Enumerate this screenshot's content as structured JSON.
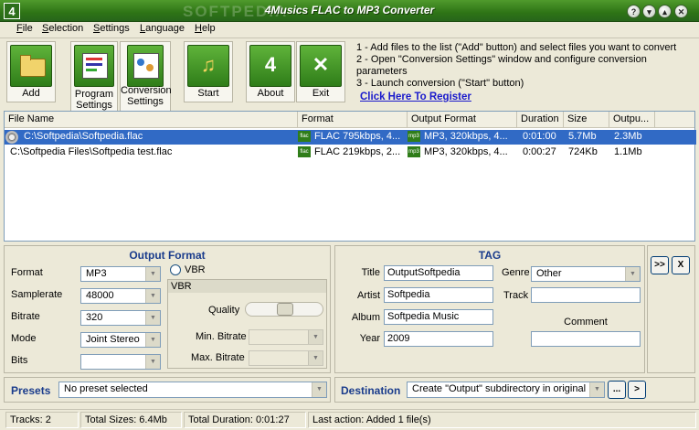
{
  "window": {
    "title": "4Musics FLAC to MP3 Converter",
    "icon_label": "4",
    "watermark": "SOFTPEDIA"
  },
  "titlebar_buttons": {
    "help": "?",
    "minimize": "▾",
    "maximize": "▴",
    "close": "✕"
  },
  "menu": [
    {
      "label": "File",
      "ul": "F",
      "rest": "ile"
    },
    {
      "label": "Selection",
      "ul": "S",
      "rest": "election"
    },
    {
      "label": "Settings",
      "ul": "S",
      "rest": "ettings"
    },
    {
      "label": "Language",
      "ul": "L",
      "rest": "anguage"
    },
    {
      "label": "Help",
      "ul": "H",
      "rest": "elp"
    }
  ],
  "toolbar": {
    "add": {
      "label": "Add",
      "icon": "folder-add-icon"
    },
    "program_settings": {
      "line1": "Program",
      "line2": "Settings",
      "icon": "program-settings-icon"
    },
    "conversion_settings": {
      "line1": "Conversion",
      "line2": "Settings",
      "icon": "conversion-settings-icon"
    },
    "start": {
      "label": "Start",
      "icon": "music-note-icon"
    },
    "about": {
      "label": "About",
      "icon": "about-4-icon",
      "glyph": "4"
    },
    "exit": {
      "label": "Exit",
      "icon": "exit-icon",
      "glyph": "✕"
    }
  },
  "instructions": [
    "1 - Add files to the list (\"Add\" button) and select files you want to convert",
    "2 - Open \"Conversion Settings\" window and configure conversion parameters",
    "3 - Launch conversion (\"Start\" button)"
  ],
  "register_link": "Click Here To Register",
  "filelist": {
    "columns": [
      "File Name",
      "Format",
      "Output Format",
      "Duration",
      "Size",
      "Outpu..."
    ],
    "rows": [
      {
        "name": "C:\\Softpedia\\Softpedia.flac",
        "format": "FLAC 795kbps, 4...",
        "output_format": "MP3, 320kbps, 4...",
        "duration": "0:01:00",
        "size": "5.7Mb",
        "output_size": "2.3Mb",
        "selected": true
      },
      {
        "name": "C:\\Softpedia Files\\Softpedia test.flac",
        "format": "FLAC 219kbps, 2...",
        "output_format": "MP3, 320kbps, 4...",
        "duration": "0:00:27",
        "size": "724Kb",
        "output_size": "1.1Mb",
        "selected": false
      }
    ]
  },
  "output_format": {
    "title": "Output Format",
    "format_label": "Format",
    "format_value": "MP3",
    "samplerate_label": "Samplerate",
    "samplerate_value": "48000",
    "bitrate_label": "Bitrate",
    "bitrate_value": "320",
    "mode_label": "Mode",
    "mode_value": "Joint Stereo",
    "bits_label": "Bits",
    "bits_value": "",
    "vbr_checkbox_label": "VBR",
    "vbr_group_title": "VBR",
    "quality_label": "Quality",
    "min_bitrate_label": "Min. Bitrate",
    "max_bitrate_label": "Max. Bitrate"
  },
  "tag": {
    "title": "TAG",
    "title_label": "Title",
    "title_value": "OutputSoftpedia",
    "artist_label": "Artist",
    "artist_value": "Softpedia",
    "album_label": "Album",
    "album_value": "Softpedia Music",
    "year_label": "Year",
    "year_value": "2009",
    "genre_label": "Genre",
    "genre_value": "Other",
    "track_label": "Track",
    "track_value": "",
    "comment_label": "Comment",
    "comment_value": ""
  },
  "side_buttons": {
    "expand": ">>",
    "close": "X"
  },
  "presets": {
    "label": "Presets",
    "value": "No preset selected"
  },
  "destination": {
    "label": "Destination",
    "value": "Create \"Output\" subdirectory in original",
    "browse": "...",
    "open": ">"
  },
  "status": {
    "tracks": "Tracks: 2",
    "total_sizes": "Total Sizes: 6.4Mb",
    "total_duration": "Total Duration: 0:01:27",
    "last_action": "Last action: Added 1 file(s)"
  }
}
